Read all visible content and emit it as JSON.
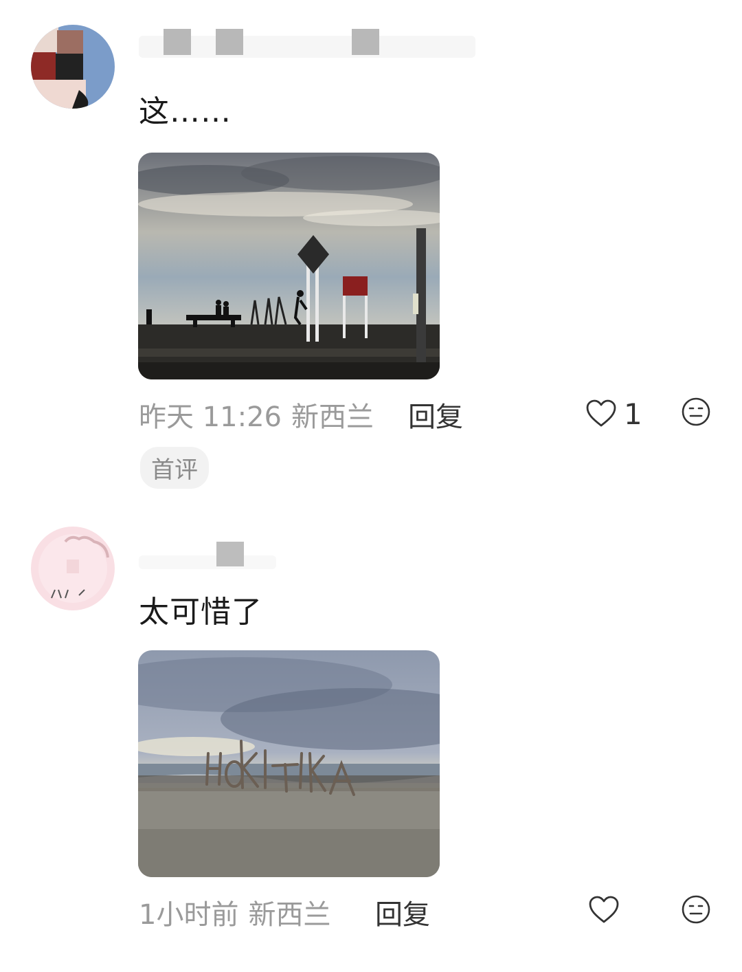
{
  "comments": [
    {
      "text": "这……",
      "time": "昨天 11:26",
      "location": "新西兰",
      "reply_label": "回复",
      "like_count": "1",
      "badge": "首评"
    },
    {
      "text": "太可惜了",
      "time": "1小时前",
      "location": "新西兰",
      "reply_label": "回复",
      "like_count": ""
    }
  ],
  "icons": {
    "like": "heart-outline-icon",
    "reaction": "neutral-face-icon"
  },
  "colors": {
    "meta_text": "#9a9a9a",
    "body_text": "#1a1a1a",
    "badge_bg": "#f2f2f2"
  }
}
